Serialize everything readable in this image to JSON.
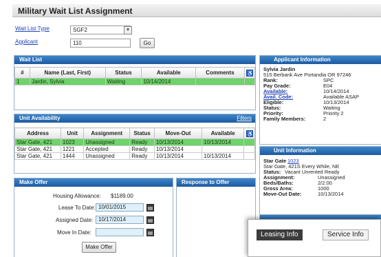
{
  "page_title": "Military Wait List Assignment",
  "form": {
    "wait_list_type_label": "Wait List Type",
    "wait_list_type_value": "SGF2",
    "applicant_label": "Applicant",
    "applicant_value": "110",
    "go_label": "Go"
  },
  "wait_list": {
    "header": "Wait List",
    "columns": [
      "#",
      "Name (Last, First)",
      "Status",
      "Available",
      "Comments"
    ],
    "rows": [
      {
        "num": "1",
        "name": "Jardin, Sylvia",
        "status": "Waiting",
        "available": "10/14/2014",
        "comments": ""
      }
    ]
  },
  "unit_availability": {
    "header": "Unit Availability",
    "filters_label": "Filters",
    "columns": [
      "Address",
      "Unit",
      "Assignment",
      "Status",
      "Move-Out",
      "Available"
    ],
    "rows": [
      {
        "address": "Star Gate, 421",
        "unit": "1023",
        "assignment": "Unassigned",
        "status": "Ready",
        "move_out": "10/13/2014",
        "available": "10/13/2014"
      },
      {
        "address": "Star Gate, 421",
        "unit": "1221",
        "assignment": "Accepted",
        "status": "Ready",
        "move_out": "10/13/2014",
        "available": ""
      },
      {
        "address": "Star Gate, 421",
        "unit": "1444",
        "assignment": "Unassigned",
        "status": "Ready",
        "move_out": "10/13/2014",
        "available": "10/13/2014"
      }
    ]
  },
  "make_offer": {
    "header": "Make Offer",
    "housing_allowance_label": "Housing Allowance:",
    "housing_allowance_value": "$1189.00",
    "lease_to_date_label": "Lease To Date:",
    "lease_to_date_value": "10/01/2015",
    "assigned_date_label": "Assigned Date:",
    "assigned_date_value": "10/17/2014",
    "move_in_date_label": "Move In Date:",
    "move_in_date_value": "",
    "button_label": "Make Offer"
  },
  "response_to_offer": {
    "header": "Response to Offer"
  },
  "applicant_info": {
    "header": "Applicant Information",
    "name": "Sylvia Jardin",
    "address": "515 Berbank Ave  Portandia OR 97246",
    "rank_label": "Rank:",
    "rank_value": "SPC",
    "pay_grade_label": "Pay Grade:",
    "pay_grade_value": "E04",
    "available_label": "Available:",
    "available_value": "10/14/2014",
    "avail_code_label": "Avail. Code:",
    "avail_code_value": "Available ASAP",
    "eligible_label": "Eligible:",
    "eligible_value": "10/13/2014",
    "status_label": "Status:",
    "status_value": "Waiting",
    "priority_label": "Priority:",
    "priority_value": "Priority 2",
    "family_members_label": "Family Members:",
    "family_members_value": "2"
  },
  "unit_info": {
    "header": "Unit Information",
    "star_gate_label": "Star Gate",
    "star_gate_link": "1023",
    "address": "Star Gate, 421S Every While, NE",
    "status_label": "Status:",
    "status_value": "Vacant Unrented Ready",
    "assignment_label": "Assignment:",
    "assignment_value": "Unassigned",
    "beds_baths_label": "Beds/Baths:",
    "beds_baths_value": "2/2.00",
    "gross_area_label": "Gross Area:",
    "gross_area_value": "1000",
    "move_out_label": "Move-Out Date:",
    "move_out_value": "10/13/2014"
  },
  "overlay": {
    "tab_leasing": "Leasing Info",
    "tab_service": "Service Info"
  }
}
